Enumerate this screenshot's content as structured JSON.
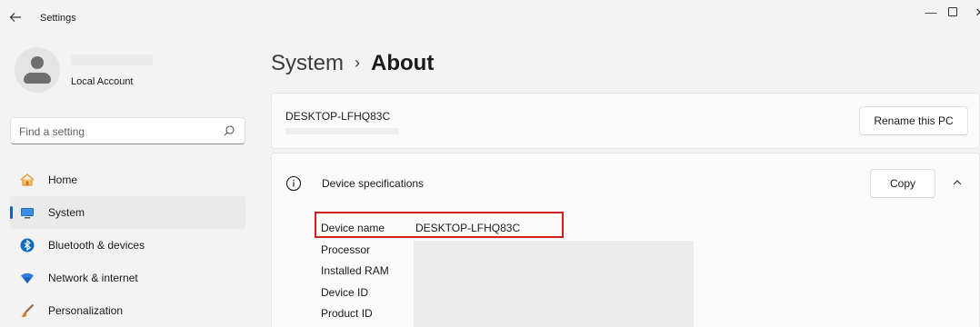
{
  "window": {
    "title": "Settings",
    "back_icon": "back-arrow-icon",
    "minimize_glyph": "—",
    "close_glyph": "✕"
  },
  "account": {
    "name": "Local Account",
    "avatar_icon": "user-avatar-icon"
  },
  "search": {
    "placeholder": "Find a setting",
    "icon": "search-icon"
  },
  "nav": {
    "items": [
      {
        "label": "Home",
        "icon": "home-icon",
        "selected": false
      },
      {
        "label": "System",
        "icon": "monitor-icon",
        "selected": true
      },
      {
        "label": "Bluetooth & devices",
        "icon": "bluetooth-icon",
        "selected": false
      },
      {
        "label": "Network & internet",
        "icon": "wifi-icon",
        "selected": false
      },
      {
        "label": "Personalization",
        "icon": "brush-icon",
        "selected": false
      }
    ]
  },
  "breadcrumb": {
    "parent": "System",
    "separator": "›",
    "current": "About"
  },
  "pc_card": {
    "pc_name": "DESKTOP-LFHQ83C",
    "rename_label": "Rename this PC"
  },
  "specs": {
    "title": "Device specifications",
    "copy_label": "Copy",
    "rows": [
      {
        "label": "Device name",
        "value": "DESKTOP-LFHQ83C"
      },
      {
        "label": "Processor",
        "value": ""
      },
      {
        "label": "Installed RAM",
        "value": ""
      },
      {
        "label": "Device ID",
        "value": ""
      },
      {
        "label": "Product ID",
        "value": ""
      }
    ]
  },
  "colors": {
    "accent": "#0067c0",
    "highlight_box": "#d01f1f",
    "background": "#f3f3f3",
    "card": "#fbfbfb"
  }
}
